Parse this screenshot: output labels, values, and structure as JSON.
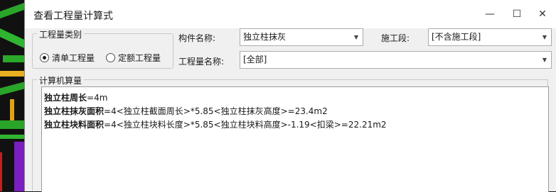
{
  "window": {
    "title": "查看工程量计算式",
    "minimize": "—",
    "maximize": "☐",
    "close": "✕"
  },
  "quantity_type": {
    "legend": "工程量类别",
    "options": [
      {
        "label": "清单工程量",
        "selected": true
      },
      {
        "label": "定额工程量",
        "selected": false
      }
    ]
  },
  "fields": {
    "component_label": "构件名称:",
    "component_value": "独立柱抹灰",
    "section_label": "施工段:",
    "section_value": "[不含施工段]",
    "quantity_name_label": "工程量名称:",
    "quantity_name_value": "[全部]"
  },
  "calc": {
    "legend": "计算机算量",
    "lines": [
      {
        "name": "独立柱周长",
        "expr": "=4m"
      },
      {
        "name": "独立柱抹灰面积",
        "expr": "=4<独立柱截面周长>*5.85<独立柱抹灰高度>=23.4m2"
      },
      {
        "name": "独立柱块料面积",
        "expr": "=4<独立柱块料长度>*5.85<独立柱块料高度>-1.19<扣梁>=22.21m2"
      }
    ]
  },
  "icons": {
    "dropdown": "chevron-down-icon"
  }
}
